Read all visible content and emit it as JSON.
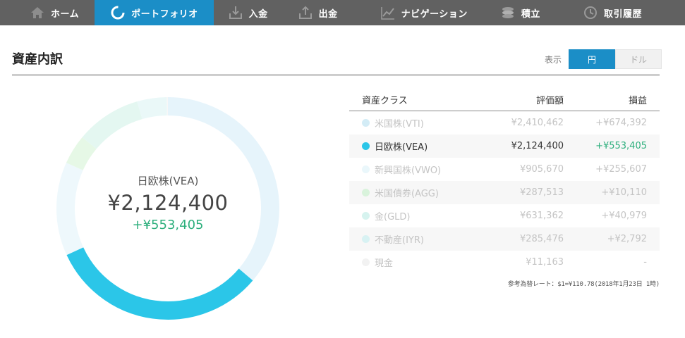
{
  "nav": {
    "items": [
      {
        "label": "ホーム",
        "icon": "home-icon",
        "active": false
      },
      {
        "label": "ポートフォリオ",
        "icon": "portfolio-ring-icon",
        "active": true
      },
      {
        "label": "入金",
        "icon": "deposit-icon",
        "active": false
      },
      {
        "label": "出金",
        "icon": "withdraw-icon",
        "active": false
      },
      {
        "label": "ナビゲーション",
        "icon": "chart-line-icon",
        "active": false
      },
      {
        "label": "積立",
        "icon": "coins-icon",
        "active": false
      },
      {
        "label": "取引履歴",
        "icon": "clock-icon",
        "active": false
      }
    ],
    "bg_color": "#616161",
    "active_color": "#1b8ec7"
  },
  "section": {
    "title": "資産内訳"
  },
  "currency": {
    "label": "表示",
    "yen": "円",
    "dollar": "ドル",
    "selected": "円"
  },
  "center": {
    "name": "日欧株(VEA)",
    "value": "¥2,124,400",
    "gain": "+¥553,405"
  },
  "table": {
    "headers": {
      "name": "資産クラス",
      "value": "評価額",
      "pl": "損益"
    },
    "rows": [
      {
        "name": "米国株(VTI)",
        "value": "¥2,410,462",
        "pl": "+¥674,392",
        "color": "#d3ecf6",
        "selected": false
      },
      {
        "name": "日欧株(VEA)",
        "value": "¥2,124,400",
        "pl": "+¥553,405",
        "color": "#2bc6e8",
        "selected": true
      },
      {
        "name": "新興国株(VWO)",
        "value": "¥905,670",
        "pl": "+¥255,607",
        "color": "#eaf7fb",
        "selected": false
      },
      {
        "name": "米国債券(AGG)",
        "value": "¥287,513",
        "pl": "+¥10,110",
        "color": "#d9f3dc",
        "selected": false
      },
      {
        "name": "金(GLD)",
        "value": "¥631,362",
        "pl": "+¥40,979",
        "color": "#d6f3ef",
        "selected": false
      },
      {
        "name": "不動産(IYR)",
        "value": "¥285,476",
        "pl": "+¥2,792",
        "color": "#d8f2f3",
        "selected": false
      },
      {
        "name": "現金",
        "value": "¥11,163",
        "pl": "-",
        "color": "#f2f2f2",
        "selected": false
      }
    ]
  },
  "note": "参考為替レート：$1=¥110.78(2018年1月23日 1時)",
  "chart_data": {
    "type": "pie",
    "categories": [
      "米国株(VTI)",
      "日欧株(VEA)",
      "新興国株(VWO)",
      "米国債券(AGG)",
      "金(GLD)",
      "不動産(IYR)",
      "現金"
    ],
    "values": [
      2410462,
      2124400,
      905670,
      287513,
      631362,
      285476,
      11163
    ],
    "colors": [
      "#e6f4fb",
      "#2bc6e8",
      "#eef8fc",
      "#e6f8e6",
      "#e4f7f1",
      "#eaf8f8",
      "#f7f7f7"
    ],
    "highlight": "日欧株(VEA)"
  }
}
